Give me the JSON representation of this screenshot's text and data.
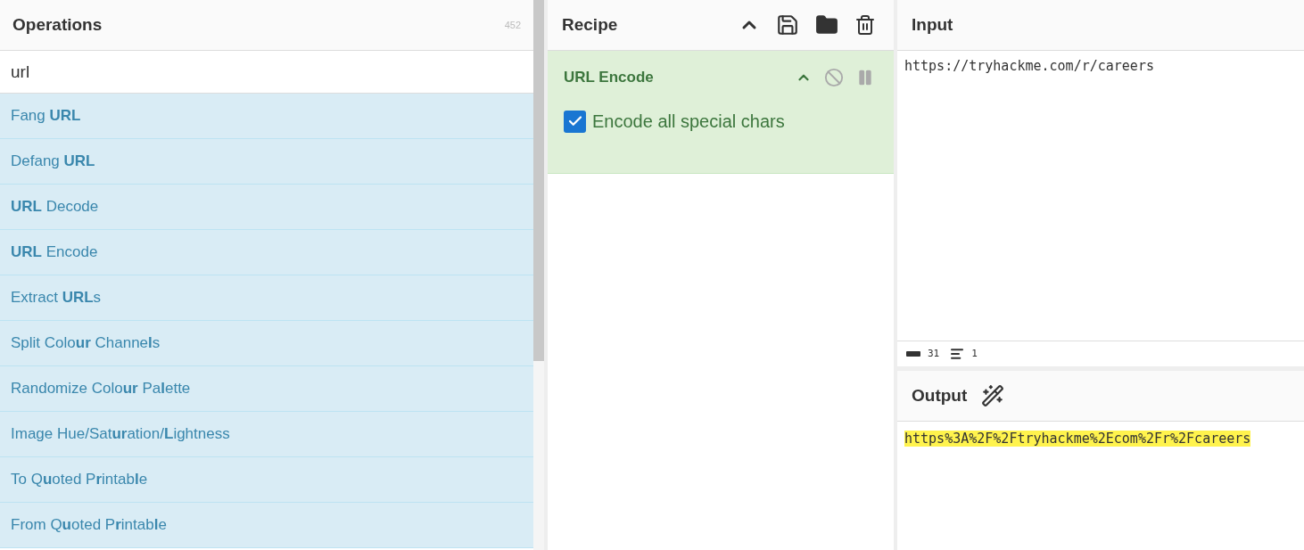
{
  "operations": {
    "title": "Operations",
    "count": "452",
    "search": {
      "value": "url"
    },
    "items": [
      {
        "label": "Fang **URL**"
      },
      {
        "label": "Defang **URL**"
      },
      {
        "label": "**URL** Decode"
      },
      {
        "label": "**URL** Encode"
      },
      {
        "label": "Extract **URL**s"
      },
      {
        "label": "Split Colo**ur** Channe**l**s"
      },
      {
        "label": "Randomize Colo**ur** Pa**l**ette"
      },
      {
        "label": "Image Hue/Sat**ur**ation/**L**ightness"
      },
      {
        "label": "To Q**u**oted P**r**intab**l**e"
      },
      {
        "label": "From Q**u**oted P**r**intab**l**e"
      }
    ]
  },
  "recipe": {
    "title": "Recipe",
    "steps": [
      {
        "name": "URL Encode",
        "disabled": false,
        "options": [
          {
            "label": "Encode all special chars",
            "checked": true
          }
        ]
      }
    ]
  },
  "input": {
    "title": "Input",
    "text": "https://tryhackme.com/r/careers",
    "status": {
      "length": "31",
      "lines": "1"
    }
  },
  "output": {
    "title": "Output",
    "text": "https%3A%2F%2Ftryhackme%2Ecom%2Fr%2Fcareers",
    "highlighted": true
  }
}
